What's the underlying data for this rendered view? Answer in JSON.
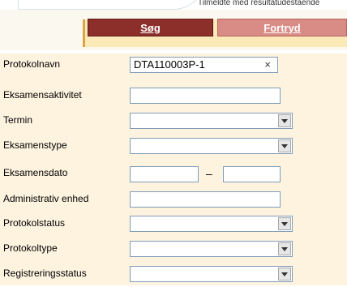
{
  "top_strip": {
    "text": "Tilmeldte med resultatudestående"
  },
  "toolbar": {
    "search_label": "Søg",
    "cancel_label": "Fortryd"
  },
  "form": {
    "protokolnavn": {
      "label": "Protokolnavn",
      "value": "DTA110003P-1",
      "clear": "×"
    },
    "eksamensaktivitet": {
      "label": "Eksamensaktivitet",
      "value": ""
    },
    "termin": {
      "label": "Termin",
      "value": ""
    },
    "eksamenstype": {
      "label": "Eksamenstype",
      "value": ""
    },
    "eksamensdato": {
      "label": "Eksamensdato",
      "from": "",
      "to": "",
      "separator": "–"
    },
    "administrativ_enhed": {
      "label": "Administrativ enhed",
      "value": ""
    },
    "protokolstatus": {
      "label": "Protokolstatus",
      "value": ""
    },
    "protokoltype": {
      "label": "Protokoltype",
      "value": ""
    },
    "registreringsstatus": {
      "label": "Registreringsstatus",
      "value": ""
    }
  },
  "colors": {
    "search_button": "#8c2f2b",
    "cancel_button": "#d98b85",
    "toolbar_bar": "#fbe9b7",
    "form_background": "#fdf3df"
  },
  "icons": {
    "select_arrow": "chevron-down-icon",
    "clear": "close-icon"
  }
}
